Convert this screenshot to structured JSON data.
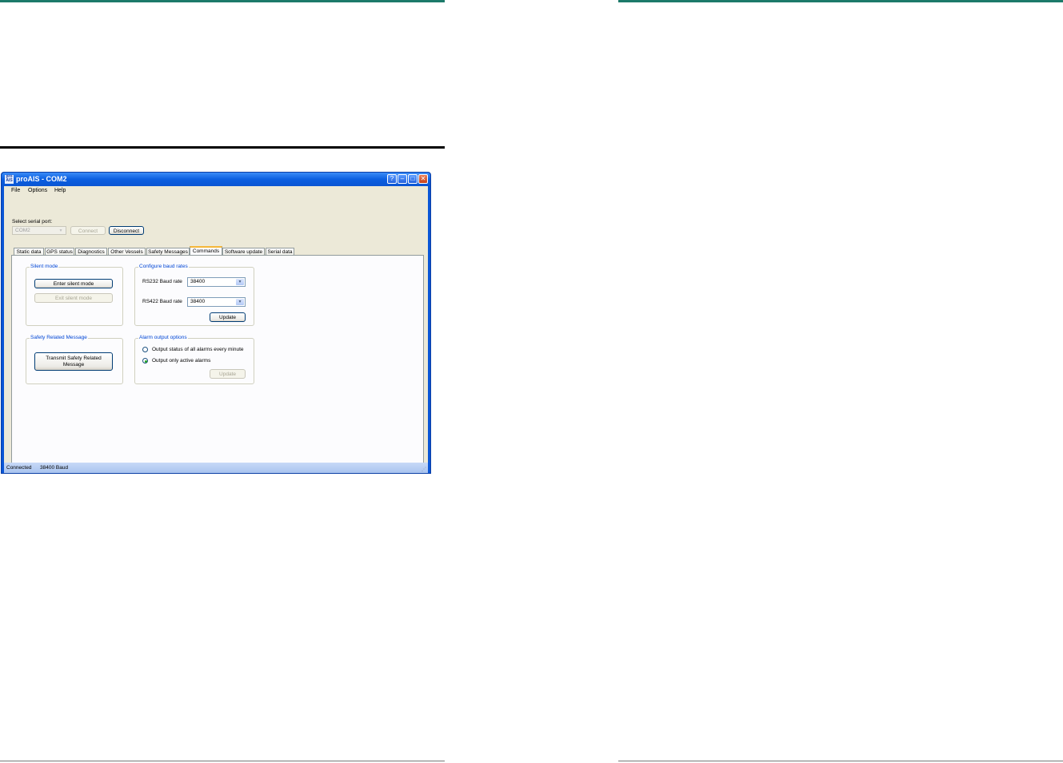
{
  "window": {
    "title": "proAIS - COM2",
    "app_icon_text": "pro AIS",
    "menu": [
      "File",
      "Options",
      "Help"
    ]
  },
  "serial": {
    "label": "Select serial port:",
    "port_value": "COM2",
    "connect_label": "Connect",
    "disconnect_label": "Disconnect"
  },
  "tabs": [
    "Static data",
    "GPS status",
    "Diagnostics",
    "Other Vessels",
    "Safety Messages",
    "Commands",
    "Software update",
    "Serial data"
  ],
  "active_tab": "Commands",
  "silent_mode": {
    "title": "Silent mode",
    "enter_label": "Enter silent mode",
    "exit_label": "Exit silent mode"
  },
  "baud": {
    "title": "Configure baud rates",
    "rs232_label": "RS232 Baud rate",
    "rs232_value": "38400",
    "rs422_label": "RS422 Baud rate",
    "rs422_value": "38400",
    "update_label": "Update"
  },
  "safety": {
    "title": "Safety Related Message",
    "transmit_line1": "Transmit Safety Related",
    "transmit_line2": "Message"
  },
  "alarm": {
    "title": "Alarm output options",
    "option_all": "Output status of all alarms every minute",
    "option_active": "Output only active alarms",
    "selected": "option_active",
    "update_label": "Update"
  },
  "status": {
    "connection": "Connected",
    "baud": "38400 Baud"
  },
  "colors": {
    "teal_rule": "#1c7a6a",
    "title_bar": "#0b5ee0",
    "group_title": "#0046d5",
    "active_tab_accent": "#f5b73a"
  }
}
